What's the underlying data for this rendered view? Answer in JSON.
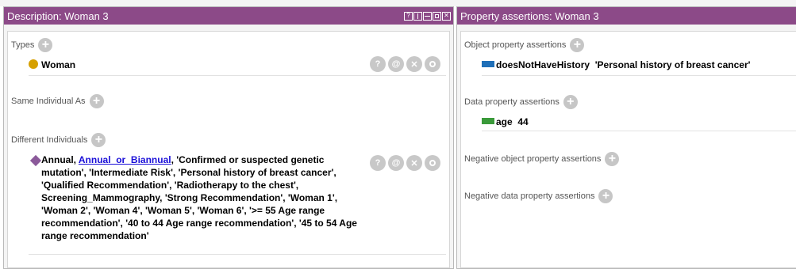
{
  "left_panel": {
    "title": "Description: Woman 3",
    "types_label": "Types",
    "type_value": "Woman",
    "same_individual_label": "Same Individual As",
    "different_individuals_label": "Different Individuals",
    "diff_prefix": "Annual, ",
    "diff_link": "Annual_or_Biannual",
    "diff_rest": ", 'Confirmed or suspected genetic mutation', 'Intermediate Risk', 'Personal history of breast cancer', 'Qualified Recommendation', 'Radiotherapy to the chest', Screening_Mammography, 'Strong Recommendation', 'Woman 1', 'Woman 2', 'Woman 4', 'Woman 5', 'Woman 6', '>= 55 Age range recommendation', '40 to 44 Age range recommendation', '45 to 54 Age range recommendation'",
    "action_help": "?",
    "action_at": "@",
    "action_delete": "✕"
  },
  "right_panel": {
    "title": "Property assertions: Woman 3",
    "object_property_label": "Object property assertions",
    "object_property_name": "doesNotHaveHistory",
    "object_property_value": "'Personal history of breast cancer'",
    "data_property_label": "Data property assertions",
    "data_property_name": "age",
    "data_property_value": "44",
    "negative_object_label": "Negative object property assertions",
    "negative_data_label": "Negative data property assertions"
  },
  "colors": {
    "title_bar": "#8c4a88",
    "class_icon": "#d6a000",
    "individual_icon": "#8b5a9a",
    "object_property_icon": "#1f6fb8",
    "data_property_icon": "#3a9a3a",
    "link": "#1a0fd8"
  },
  "icons": [
    "help-icon",
    "float-icon",
    "vertical-split-icon",
    "horizontal-split-icon",
    "maximize-icon",
    "close-icon",
    "add-icon",
    "class-circle-icon",
    "individual-diamond-icon",
    "object-property-icon",
    "data-property-icon"
  ]
}
